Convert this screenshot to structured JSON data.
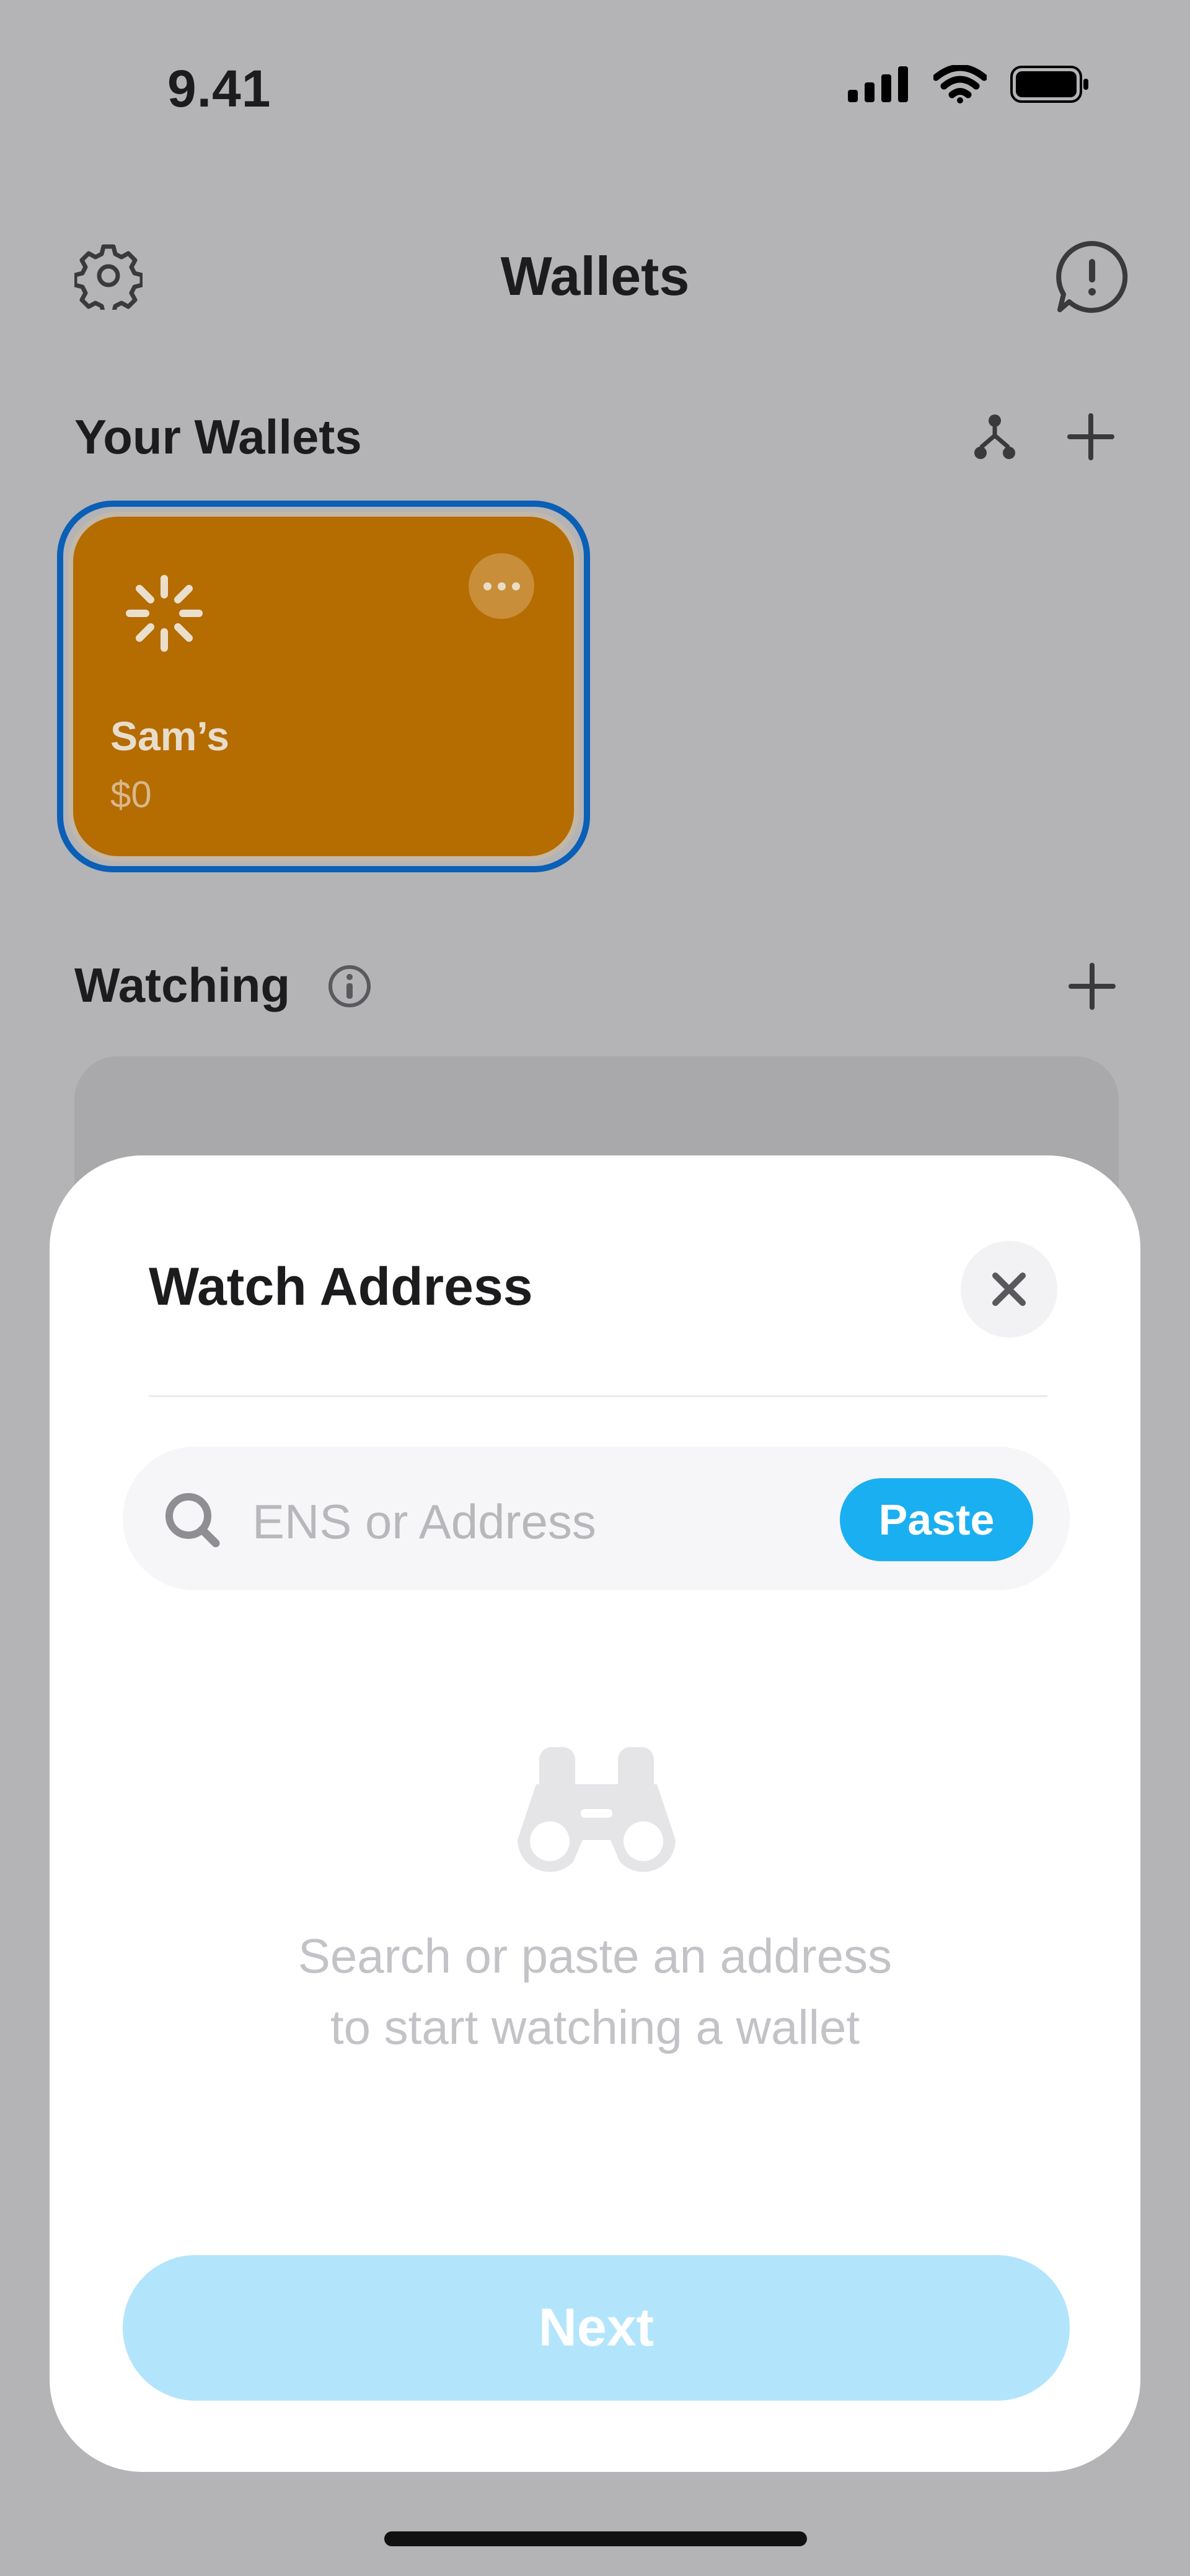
{
  "status_bar": {
    "time": "9.41",
    "icons": [
      "signal-icon",
      "wifi-icon",
      "battery-icon"
    ]
  },
  "header": {
    "title": "Wallets",
    "left_icon": "gear-icon",
    "right_icon": "feedback-icon"
  },
  "your_wallets": {
    "title": "Your Wallets",
    "actions": [
      "branch-icon",
      "plus-icon"
    ],
    "wallets": [
      {
        "name": "Sam’s",
        "balance": "$0",
        "color": "#b56c00",
        "selected": true
      }
    ]
  },
  "watching": {
    "title": "Watching",
    "icons": [
      "info-icon",
      "plus-icon"
    ]
  },
  "sheet": {
    "title": "Watch Address",
    "close_icon": "close-icon",
    "search": {
      "value": "",
      "placeholder": "ENS or Address",
      "icon": "search-icon"
    },
    "paste_label": "Paste",
    "empty_icon": "binoculars-icon",
    "empty_message_line1": "Search or paste an address",
    "empty_message_line2": "to start watching a wallet",
    "next_label": "Next"
  },
  "colors": {
    "accent": "#1aaff0",
    "next_disabled": "#b2e5fb",
    "overlay_background": "#b4b3b6",
    "selection_ring": "#0a5fb6"
  }
}
